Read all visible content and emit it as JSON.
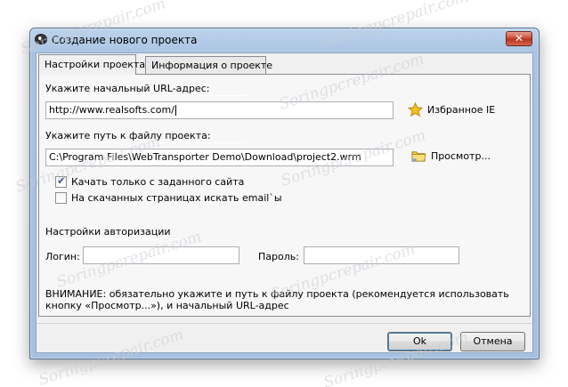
{
  "window": {
    "title": "Создание нового проекта",
    "close_glyph": "✕"
  },
  "tabs": [
    {
      "label": "Настройки проекта",
      "active": true
    },
    {
      "label": "Информация о проекте",
      "active": false
    }
  ],
  "url": {
    "label": "Укажите начальный URL-адрес:",
    "value": "http://www.realsofts.com/",
    "favorites_label": "Избранное IE",
    "favorites_icon": "star-icon"
  },
  "project_path": {
    "label": "Укажите путь к файлу проекта:",
    "value": "C:\\Program Files\\WebTransporter Demo\\Download\\project2.wrm",
    "browse_label": "Просмотр...",
    "browse_icon": "folder-icon"
  },
  "options": [
    {
      "label": "Качать только с заданного сайта",
      "checked": true
    },
    {
      "label": "На скачанных страницах искать email`ы",
      "checked": false
    }
  ],
  "auth": {
    "section_label": "Настройки авторизации",
    "login_label": "Логин:",
    "login_value": "",
    "password_label": "Пароль:",
    "password_value": ""
  },
  "note": {
    "line1": "ВНИМАНИЕ: обязательно укажите и путь к файлу проекта (рекомендуется использовать",
    "line2": "кнопку «Просмотр...»), и начальный URL-адрес"
  },
  "buttons": {
    "ok": "Ok",
    "cancel": "Отмена"
  },
  "watermark": "Soringpcrepair.com",
  "colors": {
    "titlebar": "#a9c3e2",
    "close_button": "#c9452e",
    "dialog_face": "#f0f0f0"
  }
}
